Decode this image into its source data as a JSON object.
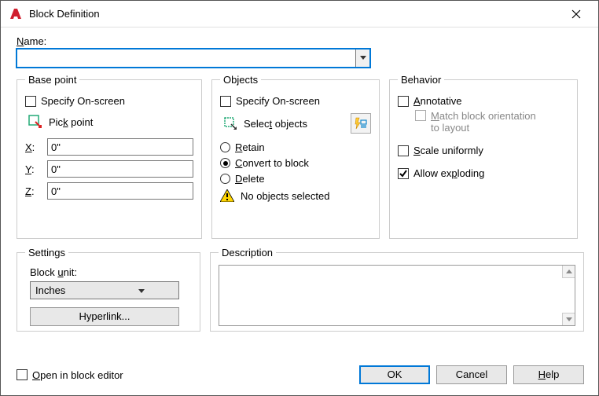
{
  "window": {
    "title": "Block Definition"
  },
  "name": {
    "label": "Name:",
    "label_u": "N",
    "value": ""
  },
  "basepoint": {
    "legend": "Base point",
    "specify_onscreen": "Specify On-screen",
    "pick_point": "Pick point",
    "x_label": "X:",
    "x_value": "0\"",
    "y_label": "Y:",
    "y_value": "0\"",
    "z_label": "Z:",
    "z_value": "0\""
  },
  "objects": {
    "legend": "Objects",
    "specify_onscreen": "Specify On-screen",
    "select_objects": "Select objects",
    "retain": "Retain",
    "convert": "Convert to block",
    "delete": "Delete",
    "no_objects": "No objects selected"
  },
  "behavior": {
    "legend": "Behavior",
    "annotative": "Annotative",
    "match_orientation": "Match block orientation\nto layout",
    "scale_uniformly": "Scale uniformly",
    "allow_exploding": "Allow exploding"
  },
  "settings": {
    "legend": "Settings",
    "block_unit_label": "Block unit:",
    "block_unit_value": "Inches",
    "hyperlink": "Hyperlink..."
  },
  "description": {
    "legend": "Description",
    "value": ""
  },
  "footer": {
    "open_in_editor": "Open in block editor",
    "ok": "OK",
    "cancel": "Cancel",
    "help": "Help"
  }
}
